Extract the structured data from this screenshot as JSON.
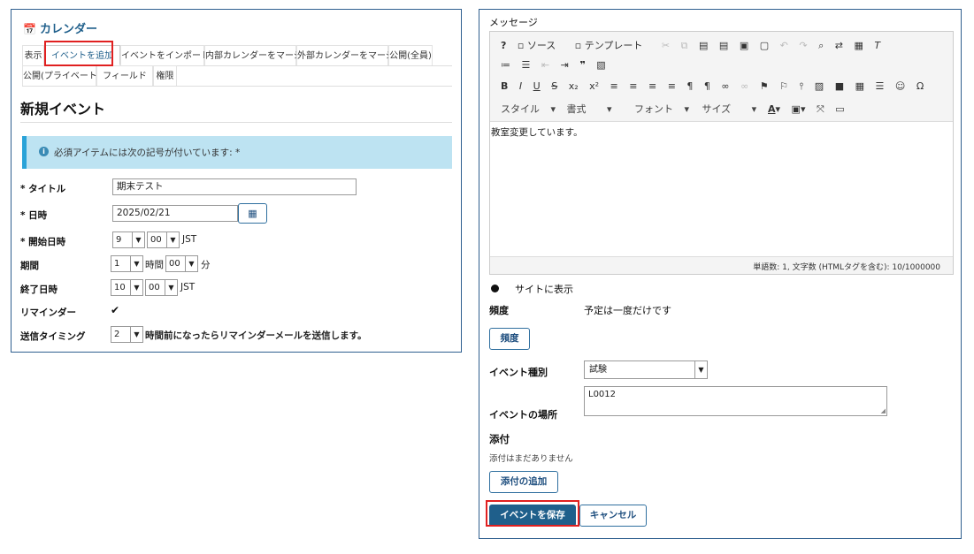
{
  "left": {
    "title": "カレンダー",
    "tabs": [
      "表示",
      "イベントを追加",
      "イベントをインポート",
      "内部カレンダーをマージ",
      "外部カレンダーをマージ",
      "公開(全員)",
      "公開(プライベート)",
      "フィールド",
      "権限"
    ],
    "heading": "新規イベント",
    "alert": "必須アイテムには次の記号が付いています: *",
    "fields": {
      "title_label": "* タイトル",
      "title_value": "期末テスト",
      "date_label": "* 日時",
      "date_value": "2025/02/21",
      "start_label": "* 開始日時",
      "start_hour": "9",
      "start_min": "00",
      "tz": "JST",
      "duration_label": "期間",
      "duration_hour": "1",
      "hour_unit": "時間",
      "duration_min": "00",
      "min_unit": "分",
      "end_label": "終了日時",
      "end_hour": "10",
      "end_min": "00",
      "reminder_label": "リマインダー",
      "reminder_checked": "✔",
      "send_label": "送信タイミング",
      "send_value": "2",
      "send_text": "時間前になったらリマインダーメールを送信します。"
    }
  },
  "right": {
    "message_label": "メッセージ",
    "toolbar": {
      "source": "ソース",
      "template": "テンプレート",
      "style": "スタイル",
      "format": "書式",
      "font": "フォント",
      "size": "サイズ"
    },
    "editor_text": "教室変更しています。",
    "status": "単語数: 1, 文字数 (HTMLタグを含む): 10/1000000",
    "show_on_site": "サイトに表示",
    "frequency_label": "頻度",
    "frequency_value": "予定は一度だけです",
    "frequency_button": "頻度",
    "event_type_label": "イベント種別",
    "event_type_value": "試験",
    "location_label": "イベントの場所",
    "location_value": "L0012",
    "attach_label": "添付",
    "attach_none": "添付はまだありません",
    "attach_button": "添付の追加",
    "save_button": "イベントを保存",
    "cancel_button": "キャンセル"
  }
}
